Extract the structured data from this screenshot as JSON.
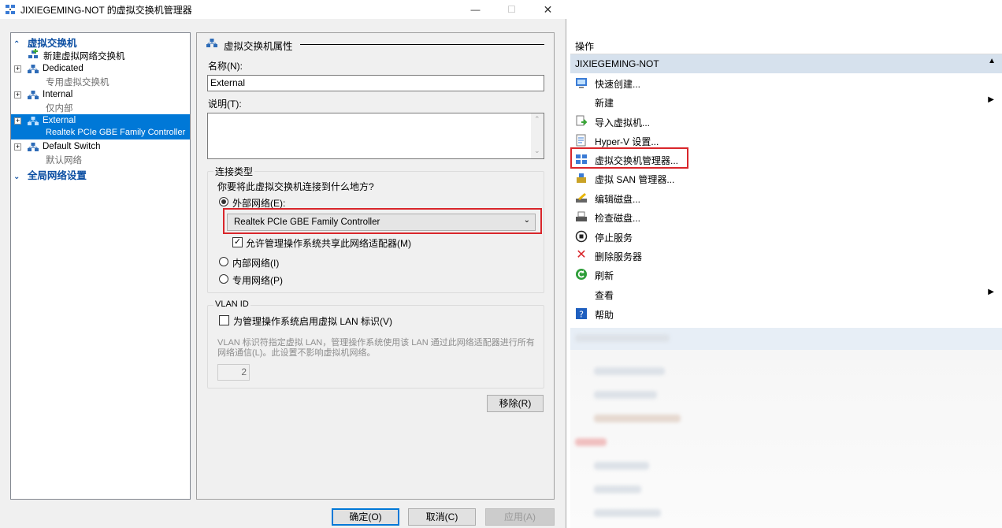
{
  "dialog": {
    "title": "JIXIEGEMING-NOT 的虚拟交换机管理器",
    "minimize": "—",
    "maximize": "☐",
    "close": "✕"
  },
  "tree": {
    "head_switches": "虚拟交换机",
    "new_switch": "新建虚拟网络交换机",
    "items": [
      {
        "name": "Dedicated",
        "sub": "专用虚拟交换机"
      },
      {
        "name": "Internal",
        "sub": "仅内部"
      },
      {
        "name": "External",
        "sub": "Realtek PCIe GBE Family Controller"
      },
      {
        "name": "Default Switch",
        "sub": "默认网络"
      }
    ],
    "head_global": "全局网络设置"
  },
  "props": {
    "section_title": "虚拟交换机属性",
    "name_label": "名称(N):",
    "name_value": "External",
    "notes_label": "说明(T):",
    "notes_value": "",
    "conn_group": "连接类型",
    "conn_question": "你要将此虚拟交换机连接到什么地方?",
    "external_label": "外部网络(E):",
    "adapter_selected": "Realtek PCIe GBE Family Controller",
    "allow_mgmt": "允许管理操作系统共享此网络适配器(M)",
    "internal_label": "内部网络(I)",
    "private_label": "专用网络(P)",
    "vlan_group": "VLAN ID",
    "vlan_enable": "为管理操作系统启用虚拟 LAN 标识(V)",
    "vlan_desc": "VLAN 标识符指定虚拟 LAN，管理操作系统使用该 LAN 通过此网络适配器进行所有网络通信(L)。此设置不影响虚拟机网络。",
    "vlan_value": "2",
    "remove_btn": "移除(R)"
  },
  "footer": {
    "ok": "确定(O)",
    "cancel": "取消(C)",
    "apply": "应用(A)"
  },
  "actions": {
    "header": "操作",
    "server": "JIXIEGEMING-NOT",
    "items": [
      {
        "label": "快速创建...",
        "icon": "quick-create-icon"
      },
      {
        "label": "新建",
        "icon": "none"
      },
      {
        "label": "导入虚拟机...",
        "icon": "import-icon"
      },
      {
        "label": "Hyper-V 设置...",
        "icon": "settings-icon"
      },
      {
        "label": "虚拟交换机管理器...",
        "icon": "switch-manager-icon"
      },
      {
        "label": "虚拟 SAN 管理器...",
        "icon": "san-icon"
      },
      {
        "label": "编辑磁盘...",
        "icon": "edit-disk-icon"
      },
      {
        "label": "检查磁盘...",
        "icon": "inspect-disk-icon"
      },
      {
        "label": "停止服务",
        "icon": "stop-icon"
      },
      {
        "label": "删除服务器",
        "icon": "delete-icon"
      },
      {
        "label": "刷新",
        "icon": "refresh-icon"
      },
      {
        "label": "查看",
        "icon": "none"
      },
      {
        "label": "帮助",
        "icon": "help-icon"
      }
    ]
  },
  "colors": {
    "highlight": "#d9262b",
    "selection": "#0078d7",
    "tree_header": "#0b4ea2"
  }
}
